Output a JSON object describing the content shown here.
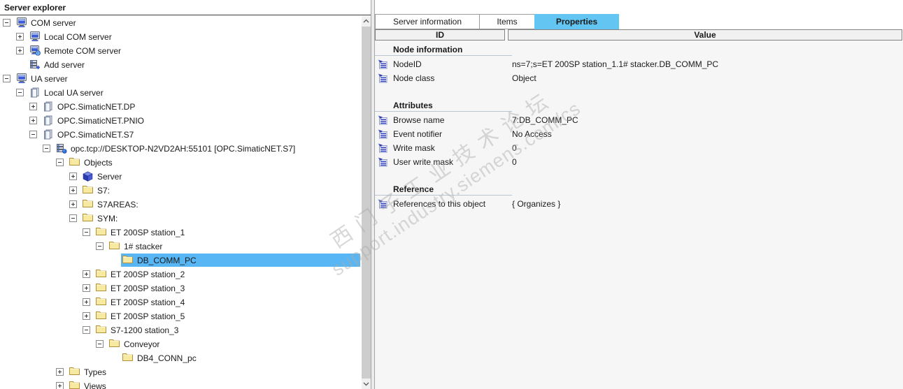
{
  "window": {
    "title": "Server explorer"
  },
  "colors": {
    "selection": "#57b6f3",
    "tab_active": "#63c5f1",
    "folder": "#f7e9a0",
    "header_bg": "#f1f1f1"
  },
  "tree": {
    "nodes": [
      {
        "level": 0,
        "expander": "minus",
        "icon": "computer",
        "label": "COM server"
      },
      {
        "level": 1,
        "expander": "plus",
        "icon": "computer",
        "label": "Local COM server"
      },
      {
        "level": 1,
        "expander": "plus",
        "icon": "computer-globe",
        "label": "Remote COM server"
      },
      {
        "level": 1,
        "expander": null,
        "icon": "server-add",
        "label": "Add server"
      },
      {
        "level": 0,
        "expander": "minus",
        "icon": "computer",
        "label": "UA server"
      },
      {
        "level": 1,
        "expander": "minus",
        "icon": "ledger",
        "label": "Local UA server"
      },
      {
        "level": 2,
        "expander": "plus",
        "icon": "ledger",
        "label": "OPC.SimaticNET.DP"
      },
      {
        "level": 2,
        "expander": "plus",
        "icon": "ledger",
        "label": "OPC.SimaticNET.PNIO"
      },
      {
        "level": 2,
        "expander": "minus",
        "icon": "ledger",
        "label": "OPC.SimaticNET.S7"
      },
      {
        "level": 3,
        "expander": "minus",
        "icon": "server-dot",
        "label": "opc.tcp://DESKTOP-N2VD2AH:55101 [OPC.SimaticNET.S7]"
      },
      {
        "level": 4,
        "expander": "minus",
        "icon": "folder",
        "label": "Objects"
      },
      {
        "level": 5,
        "expander": "plus",
        "icon": "cube",
        "label": "Server"
      },
      {
        "level": 5,
        "expander": "plus",
        "icon": "folder",
        "label": "S7:"
      },
      {
        "level": 5,
        "expander": "plus",
        "icon": "folder",
        "label": "S7AREAS:"
      },
      {
        "level": 5,
        "expander": "minus",
        "icon": "folder",
        "label": "SYM:"
      },
      {
        "level": 6,
        "expander": "minus",
        "icon": "folder",
        "label": "ET 200SP station_1"
      },
      {
        "level": 7,
        "expander": "minus",
        "icon": "folder",
        "label": "1# stacker"
      },
      {
        "level": 8,
        "expander": null,
        "icon": "folder",
        "label": "DB_COMM_PC",
        "selected": true
      },
      {
        "level": 6,
        "expander": "plus",
        "icon": "folder",
        "label": "ET 200SP station_2"
      },
      {
        "level": 6,
        "expander": "plus",
        "icon": "folder",
        "label": "ET 200SP station_3"
      },
      {
        "level": 6,
        "expander": "plus",
        "icon": "folder",
        "label": "ET 200SP station_4"
      },
      {
        "level": 6,
        "expander": "plus",
        "icon": "folder",
        "label": "ET 200SP station_5"
      },
      {
        "level": 6,
        "expander": "minus",
        "icon": "folder",
        "label": "S7-1200 station_3"
      },
      {
        "level": 7,
        "expander": "minus",
        "icon": "folder",
        "label": "Conveyor"
      },
      {
        "level": 8,
        "expander": null,
        "icon": "folder",
        "label": "DB4_CONN_pc"
      },
      {
        "level": 4,
        "expander": "plus",
        "icon": "folder",
        "label": "Types"
      },
      {
        "level": 4,
        "expander": "plus",
        "icon": "folder",
        "label": "Views"
      }
    ]
  },
  "tabs": [
    {
      "label": "Server information",
      "active": false
    },
    {
      "label": "Items",
      "active": false
    },
    {
      "label": "Properties",
      "active": true
    }
  ],
  "grid": {
    "columns": [
      "ID",
      "Value"
    ]
  },
  "properties": {
    "sections": [
      {
        "title": "Node information",
        "items": [
          {
            "label": "NodeID",
            "value": "ns=7;s=ET 200SP station_1.1# stacker.DB_COMM_PC"
          },
          {
            "label": "Node class",
            "value": "Object"
          }
        ]
      },
      {
        "title": "Attributes",
        "items": [
          {
            "label": "Browse name",
            "value": "7:DB_COMM_PC"
          },
          {
            "label": "Event notifier",
            "value": "No Access"
          },
          {
            "label": "Write mask",
            "value": "0"
          },
          {
            "label": "User write mask",
            "value": "0"
          }
        ]
      },
      {
        "title": "Reference",
        "items": [
          {
            "label": "References to this object",
            "value": "{ Organizes }"
          }
        ]
      }
    ]
  },
  "watermark": {
    "line1": "西门子工业技术论坛",
    "line2": "support.industry.siemens.com/cs"
  }
}
